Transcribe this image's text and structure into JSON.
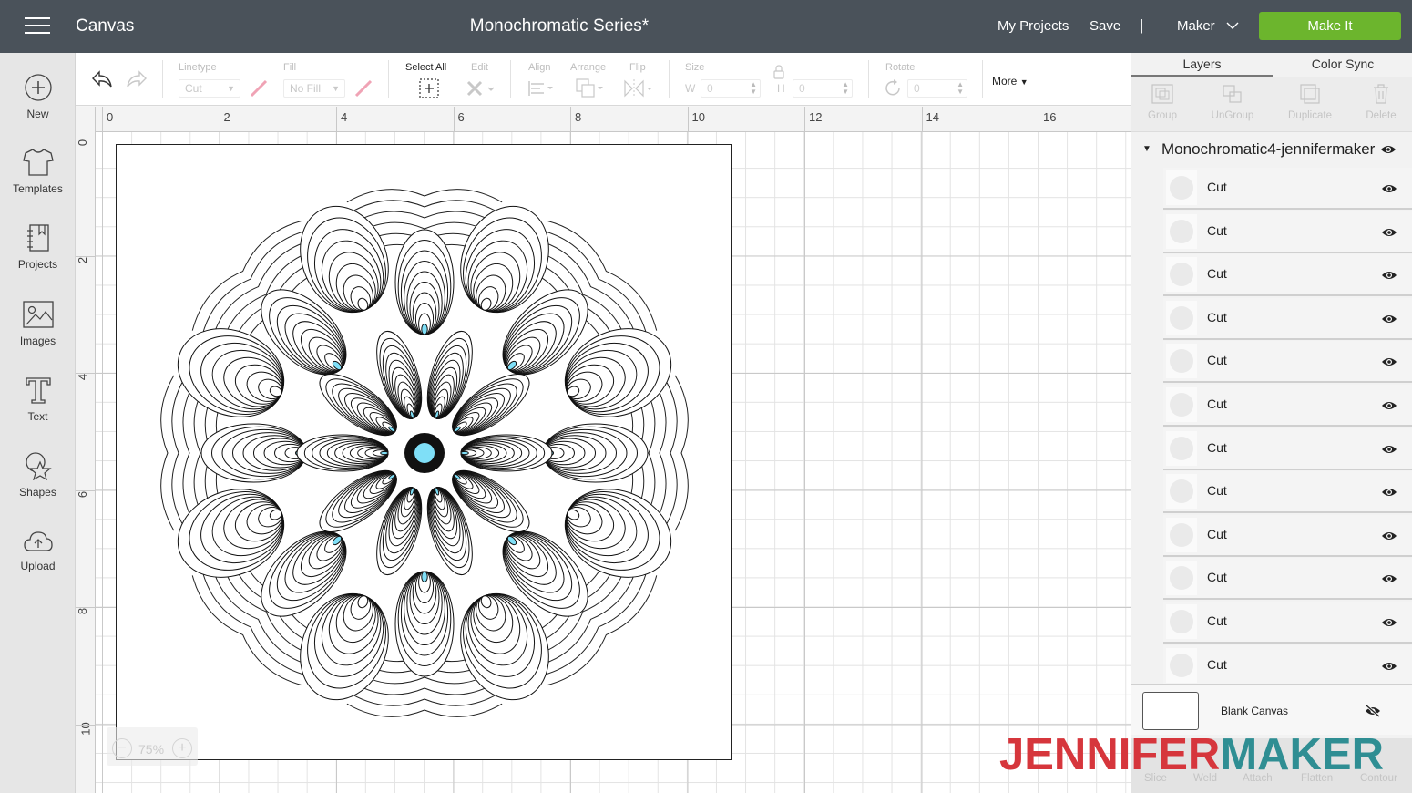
{
  "header": {
    "app_name": "Canvas",
    "document_title": "Monochromatic Series*",
    "my_projects": "My Projects",
    "save": "Save",
    "separator": "|",
    "machine": "Maker",
    "make_it": "Make It"
  },
  "sidebar": {
    "items": [
      {
        "label": "New",
        "icon": "plus-circle-icon"
      },
      {
        "label": "Templates",
        "icon": "tshirt-icon"
      },
      {
        "label": "Projects",
        "icon": "notebook-icon"
      },
      {
        "label": "Images",
        "icon": "image-icon"
      },
      {
        "label": "Text",
        "icon": "text-t-icon"
      },
      {
        "label": "Shapes",
        "icon": "shapes-icon"
      },
      {
        "label": "Upload",
        "icon": "cloud-upload-icon"
      }
    ]
  },
  "toolbar": {
    "linetype_label": "Linetype",
    "linetype_value": "Cut",
    "fill_label": "Fill",
    "fill_value": "No Fill",
    "select_all": "Select All",
    "edit": "Edit",
    "align": "Align",
    "arrange": "Arrange",
    "flip": "Flip",
    "size": "Size",
    "w_label": "W",
    "w_value": "0",
    "h_label": "H",
    "h_value": "0",
    "rotate": "Rotate",
    "rotate_value": "0",
    "more": "More"
  },
  "rulers": {
    "top": [
      "0",
      "2",
      "4",
      "6",
      "8",
      "10",
      "12",
      "14",
      "16"
    ],
    "left": [
      "0",
      "2",
      "4",
      "6",
      "8",
      "10"
    ]
  },
  "zoom": {
    "value": "75%",
    "minus": "−",
    "plus": "+"
  },
  "panel": {
    "tabs": [
      "Layers",
      "Color Sync"
    ],
    "actions": [
      "Group",
      "UnGroup",
      "Duplicate",
      "Delete"
    ],
    "group_name": "Monochromatic4-jennifermaker",
    "layers": [
      {
        "name": "Cut"
      },
      {
        "name": "Cut"
      },
      {
        "name": "Cut"
      },
      {
        "name": "Cut"
      },
      {
        "name": "Cut"
      },
      {
        "name": "Cut"
      },
      {
        "name": "Cut"
      },
      {
        "name": "Cut"
      },
      {
        "name": "Cut"
      },
      {
        "name": "Cut"
      },
      {
        "name": "Cut"
      },
      {
        "name": "Cut"
      }
    ],
    "blank_canvas": "Blank Canvas",
    "bottom_actions": [
      "Slice",
      "Weld",
      "Attach",
      "Flatten",
      "Contour"
    ]
  },
  "watermark": {
    "part1": "JENNIFER",
    "part2": "MAKER"
  },
  "colors": {
    "header_bg": "#4a525a",
    "make_it_green": "#6cb52d",
    "accent_cyan": "#7fdff7",
    "watermark_red": "#d6363c",
    "watermark_teal": "#2f8e93"
  }
}
